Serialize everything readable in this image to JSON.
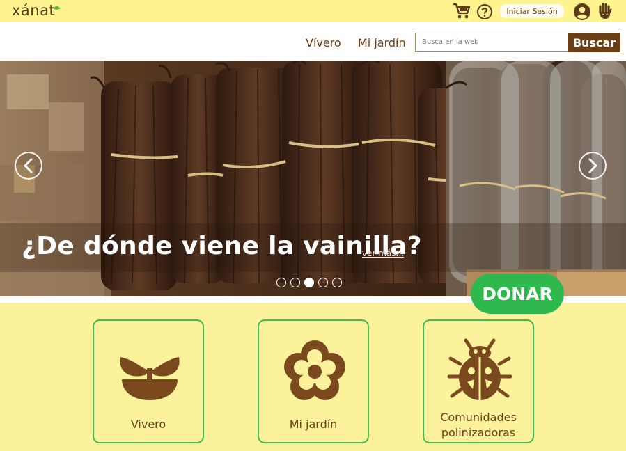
{
  "header": {
    "logo_text": "xánat",
    "icons": [
      "cart-icon",
      "help-icon",
      "user-icon",
      "hand-icon"
    ],
    "login_label": "Iniciar Sesión"
  },
  "nav": {
    "links": [
      "Vívero",
      "Mi jardín"
    ],
    "search_placeholder": "Busca en la web",
    "search_button": "Buscar"
  },
  "hero": {
    "headline": "¿De dónde viene la vainilla?",
    "more_link": "ver más...",
    "slides_count": 5,
    "active_slide": 3
  },
  "cta": {
    "donate_label": "DONAR"
  },
  "cards": [
    {
      "label": "Vivero",
      "icon": "sprout-icon"
    },
    {
      "label": "Mi jardín",
      "icon": "flower-icon"
    },
    {
      "label": "Comunidades polinizadoras",
      "icon": "ladybug-icon"
    }
  ],
  "colors": {
    "brand_yellow": "#fdf29c",
    "brand_brown": "#6b3f16",
    "donate_green": "#2fb84d",
    "card_border": "#3fbf4f"
  }
}
